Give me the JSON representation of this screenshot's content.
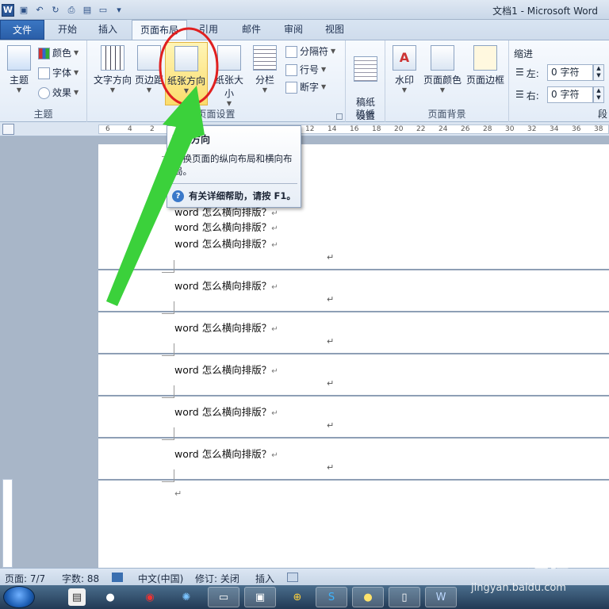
{
  "window": {
    "title": "文档1 - Microsoft Word"
  },
  "tabs": [
    {
      "label": "文件"
    },
    {
      "label": "开始"
    },
    {
      "label": "插入"
    },
    {
      "label": "页面布局"
    },
    {
      "label": "引用"
    },
    {
      "label": "邮件"
    },
    {
      "label": "审阅"
    },
    {
      "label": "视图"
    }
  ],
  "ribbon": {
    "theme_group": {
      "label": "主题",
      "theme": "主题",
      "colors": "颜色",
      "fonts": "字体",
      "effects": "效果"
    },
    "page_setup_group": {
      "label": "页面设置",
      "text_direction": "文字方向",
      "margins": "页边距",
      "orientation": "纸张方向",
      "size": "纸张大小",
      "columns": "分栏",
      "breaks": "分隔符",
      "line_numbers": "行号",
      "hyphenation": "断字"
    },
    "draft_group": {
      "label": "稿纸",
      "draft_setup": "稿纸\n设置"
    },
    "background_group": {
      "label": "页面背景",
      "watermark": "水印",
      "page_color": "页面颜色",
      "page_borders": "页面边框"
    },
    "indent_group": {
      "label": "缩进",
      "left_label": "左:",
      "left_value": "0 字符",
      "right_label": "右:",
      "right_value": "0 字符",
      "next": "段"
    }
  },
  "ruler": {
    "ticks": [
      "6",
      "4",
      "2",
      "",
      "2",
      "4",
      "6",
      "8",
      "10",
      "12",
      "14",
      "16",
      "18",
      "20",
      "22",
      "24",
      "26",
      "28",
      "30",
      "32",
      "34",
      "36",
      "38"
    ]
  },
  "tooltip": {
    "title": "页面方向",
    "description": "切换页面的纵向布局和横向布局。",
    "help": "有关详细帮助，请按 F1。"
  },
  "document": {
    "lines": [
      "word 怎么横向排版？",
      "word 怎么横向排版？",
      "word 怎么横向排版？",
      "word 怎么横向排版？",
      "word 怎么横向排版？",
      "word 怎么横向排版？",
      "word 怎么横向排版？",
      "word 怎么横向排版？",
      "word 怎么横向排版？"
    ],
    "paragraph_mark": "↵"
  },
  "status": {
    "page": "页面: 7/7",
    "words": "字数: 88",
    "language": "中文(中国)",
    "track_changes": "修订: 关闭",
    "insert_mode": "插入"
  },
  "taskbar": {
    "icons": [
      "start-orb-icon",
      "folder-icon",
      "qq-icon",
      "netease-music-icon",
      "orb-icon",
      "explorer-icon",
      "paint-icon",
      "360-icon",
      "sogou-icon",
      "chat-icon",
      "notepad-icon",
      "word-icon"
    ]
  },
  "watermark": {
    "brand": "Baidu经验",
    "url": "jingyan.baidu.com"
  },
  "colors": {
    "file_tab": "#2a5ea8",
    "highlight": "#fbdc6c",
    "annotation_circle": "#e02020",
    "annotation_arrow": "#3bd13b"
  }
}
